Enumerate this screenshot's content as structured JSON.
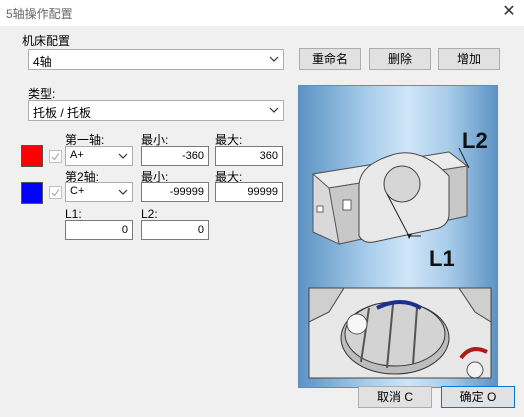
{
  "window": {
    "title": "5轴操作配置",
    "close_glyph": "✕"
  },
  "machine": {
    "group_label": "机床配置",
    "selected": "4轴",
    "rename_label": "重命名",
    "delete_label": "删除",
    "add_label": "增加"
  },
  "type": {
    "label": "类型:",
    "selected": "托板 / 托板"
  },
  "axis1": {
    "label": "第一轴:",
    "selected": "A+",
    "min_label": "最小:",
    "max_label": "最大:",
    "min": "-360",
    "max": "360",
    "color": "#ff0000"
  },
  "axis2": {
    "label": "第2轴:",
    "selected": "C+",
    "min_label": "最小:",
    "max_label": "最大:",
    "min": "-99999",
    "max": "99999",
    "color": "#0000ff"
  },
  "l1": {
    "label": "L1:",
    "value": "0"
  },
  "l2": {
    "label": "L2:",
    "value": "0"
  },
  "diagram": {
    "l2_label": "L2",
    "l1_label": "L1"
  },
  "footer": {
    "cancel_label": "取消 C",
    "ok_label": "确定 O"
  }
}
